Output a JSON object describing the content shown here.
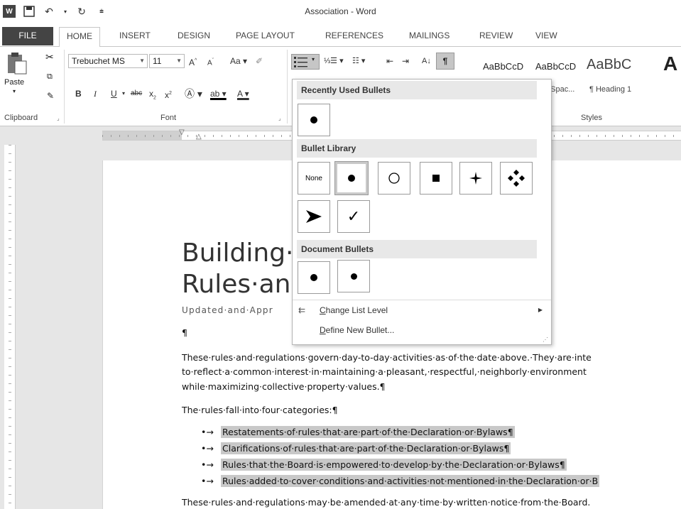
{
  "window": {
    "title": "Association - Word"
  },
  "tabs": [
    {
      "label": "FILE"
    },
    {
      "label": "HOME"
    },
    {
      "label": "INSERT"
    },
    {
      "label": "DESIGN"
    },
    {
      "label": "PAGE LAYOUT"
    },
    {
      "label": "REFERENCES"
    },
    {
      "label": "MAILINGS"
    },
    {
      "label": "REVIEW"
    },
    {
      "label": "VIEW"
    }
  ],
  "ribbon": {
    "clipboard": {
      "paste_label": "Paste",
      "group_label": "Clipboard"
    },
    "font": {
      "font_name": "Trebuchet MS",
      "font_size": "11",
      "group_label": "Font"
    },
    "styles": {
      "group_label": "Styles",
      "items": [
        {
          "sample": "AaBbCcD",
          "name": ""
        },
        {
          "sample": "AaBbCcD",
          "name": "No Spac..."
        },
        {
          "sample": "AaBbC",
          "name": "¶ Heading 1"
        },
        {
          "sample": "A",
          "name": ""
        }
      ]
    }
  },
  "dropdown": {
    "recently_used_header": "Recently Used Bullets",
    "library_header": "Bullet Library",
    "document_header": "Document Bullets",
    "none_label": "None",
    "change_level": "Change List Level",
    "change_level_accel": "C",
    "change_level_rest": "hange List Level",
    "define_new_accel": "D",
    "define_new_rest": "efine New Bullet..."
  },
  "document": {
    "title_line1": "Building·",
    "title_line2": "Rules·an",
    "subtitle": "Updated·and·Appr",
    "pilcrow": "¶",
    "para1_line1": "These·rules·and·regulations·govern·day-to-day·activities·as·of·the·date·above.·They·are·inte",
    "para1_line2": "to·reflect·a·common·interest·in·maintaining·a·pleasant,·respectful,·neighborly·environment",
    "para1_line3": "while·maximizing·collective·property·values.¶",
    "para2": "The·rules·fall·into·four·categories:¶",
    "bullets": [
      "Restatements·of·rules·that·are·part·of·the·Declaration·or·Bylaws¶",
      "Clarifications·of·rules·that·are·part·of·the·Declaration·or·Bylaws¶",
      "Rules·that·the·Board·is·empowered·to·develop·by·the·Declaration·or·Bylaws¶",
      "Rules·added·to·cover·conditions·and·activities·not·mentioned·in·the·Declaration·or·B"
    ],
    "bullet_marker": "•→",
    "para3": "These·rules·and·regulations·may·be·amended·at·any·time·by·written·notice·from·the·Board."
  }
}
